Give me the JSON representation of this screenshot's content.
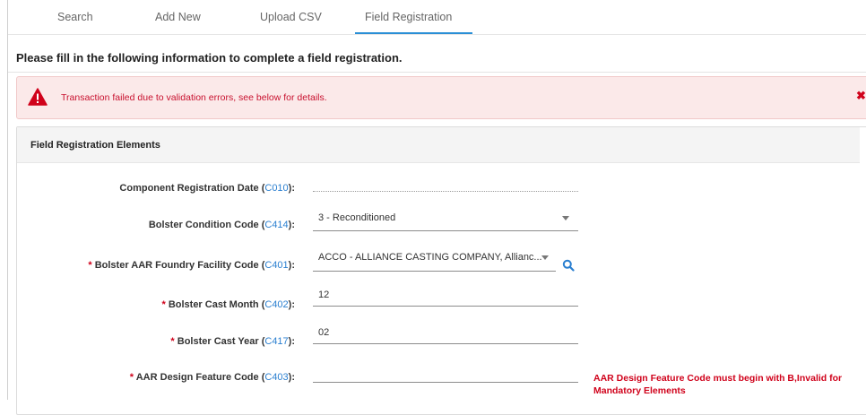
{
  "tabs": [
    {
      "label": "Search"
    },
    {
      "label": "Add New"
    },
    {
      "label": "Upload CSV"
    },
    {
      "label": "Field Registration"
    }
  ],
  "active_tab": "Field Registration",
  "heading": "Please fill in the following information to complete a field registration.",
  "alert": {
    "message": "Transaction failed due to validation errors, see below for details.",
    "close_glyph": "✖",
    "icon": "warning-triangle-icon"
  },
  "panel": {
    "title": "Field Registration Elements"
  },
  "fields": {
    "component_registration_date": {
      "label": "Component Registration Date (",
      "code": "C010",
      "suffix": "):",
      "value": ""
    },
    "bolster_condition_code": {
      "label": "Bolster Condition Code (",
      "code": "C414",
      "suffix": "):",
      "value": "3 - Reconditioned"
    },
    "bolster_foundry_code": {
      "required": "* ",
      "label": "Bolster AAR Foundry Facility Code (",
      "code": "C401",
      "suffix": "):",
      "value": "ACCO - ALLIANCE CASTING COMPANY, Allianc..."
    },
    "bolster_cast_month": {
      "required": "* ",
      "label": "Bolster Cast Month (",
      "code": "C402",
      "suffix": "):",
      "value": "12"
    },
    "bolster_cast_year": {
      "required": "* ",
      "label": "Bolster Cast Year (",
      "code": "C417",
      "suffix": "):",
      "value": "02"
    },
    "aar_design_feature_code": {
      "required": "* ",
      "label": "AAR Design Feature Code (",
      "code": "C403",
      "suffix": "):",
      "value": "",
      "error": "AAR Design Feature Code must begin with B,Invalid for Mandatory Elements"
    }
  },
  "colors": {
    "accent": "#2a8fd6",
    "error": "#d0021b",
    "alert_bg": "#fbe9e9"
  }
}
